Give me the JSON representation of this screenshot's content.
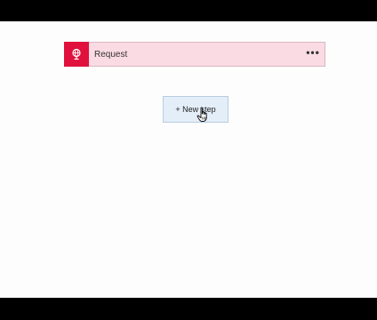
{
  "flow": {
    "trigger": {
      "title": "Request",
      "icon": "request-globe-icon",
      "accent_color": "#e0113d",
      "card_color": "#fadbe3",
      "more_label": "•••"
    },
    "new_step": {
      "label": "+ New step",
      "color": "#e3eef9"
    }
  },
  "cursor": {
    "icon": "hand-pointer-icon"
  }
}
